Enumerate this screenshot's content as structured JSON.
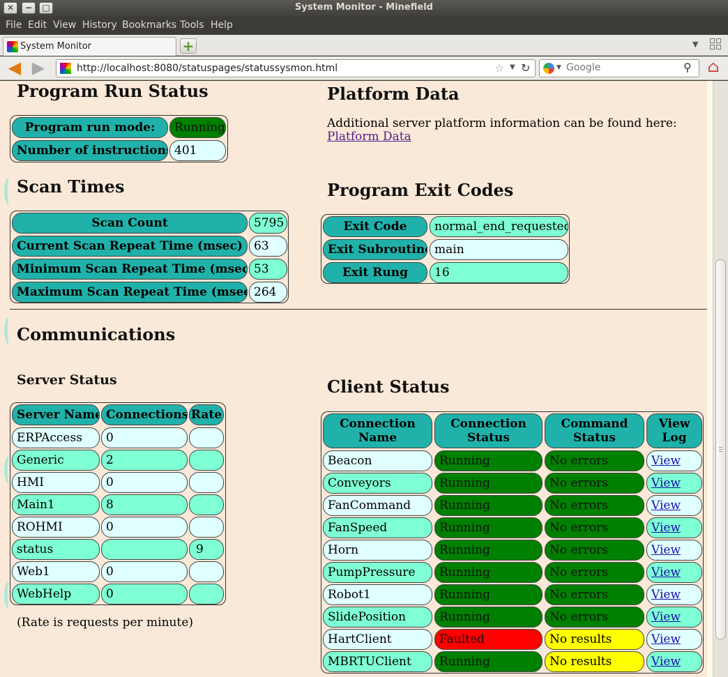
{
  "window": {
    "title": "System Monitor - Minefield"
  },
  "menu": [
    "File",
    "Edit",
    "View",
    "History",
    "Bookmarks",
    "Tools",
    "Help"
  ],
  "tab": {
    "label": "System Monitor",
    "new_tab": "+"
  },
  "nav": {
    "url": "http://localhost:8080/statuspages/statussysmon.html",
    "search_placeholder": "Google"
  },
  "program_run": {
    "title": "Program Run Status",
    "rows": [
      {
        "label": "Program run mode:",
        "value": "Running",
        "status": "green"
      },
      {
        "label": "Number of instructions",
        "value": "401",
        "status": "light"
      }
    ]
  },
  "platform": {
    "title": "Platform Data",
    "text": "Additional server platform information can be found here:",
    "link": "Platform Data"
  },
  "scan_times": {
    "title": "Scan Times",
    "rows": [
      {
        "label": "Scan Count",
        "value": "5795"
      },
      {
        "label": "Current Scan Repeat Time (msec)",
        "value": "63"
      },
      {
        "label": "Minimum Scan Repeat Time (msec)",
        "value": "53"
      },
      {
        "label": "Maximum Scan Repeat Time (msec)",
        "value": "264"
      }
    ]
  },
  "exit_codes": {
    "title": "Program Exit Codes",
    "rows": [
      {
        "label": "Exit Code",
        "value": "normal_end_requested"
      },
      {
        "label": "Exit Subroutine",
        "value": "main"
      },
      {
        "label": "Exit Rung",
        "value": "16"
      }
    ]
  },
  "communications": {
    "title": "Communications"
  },
  "server_status": {
    "title": "Server Status",
    "headers": [
      "Server Name",
      "Connections",
      "Rate"
    ],
    "rows": [
      [
        "ERPAccess",
        "0",
        ""
      ],
      [
        "Generic",
        "2",
        ""
      ],
      [
        "HMI",
        "0",
        ""
      ],
      [
        "Main1",
        "8",
        ""
      ],
      [
        "ROHMI",
        "0",
        ""
      ],
      [
        "status",
        "",
        "9"
      ],
      [
        "Web1",
        "0",
        ""
      ],
      [
        "WebHelp",
        "0",
        ""
      ]
    ],
    "note": "(Rate is requests per minute)"
  },
  "client_status": {
    "title": "Client Status",
    "headers": [
      [
        "Connection",
        "Name"
      ],
      [
        "Connection",
        "Status"
      ],
      [
        "Command",
        "Status"
      ],
      [
        "View",
        "Log"
      ]
    ],
    "rows": [
      {
        "name": "Beacon",
        "conn": "Running",
        "conn_color": "green",
        "cmd": "No errors",
        "cmd_color": "green",
        "log": "View"
      },
      {
        "name": "Conveyors",
        "conn": "Running",
        "conn_color": "green",
        "cmd": "No errors",
        "cmd_color": "green",
        "log": "View"
      },
      {
        "name": "FanCommand",
        "conn": "Running",
        "conn_color": "green",
        "cmd": "No errors",
        "cmd_color": "green",
        "log": "View"
      },
      {
        "name": "FanSpeed",
        "conn": "Running",
        "conn_color": "green",
        "cmd": "No errors",
        "cmd_color": "green",
        "log": "View"
      },
      {
        "name": "Horn",
        "conn": "Running",
        "conn_color": "green",
        "cmd": "No errors",
        "cmd_color": "green",
        "log": "View"
      },
      {
        "name": "PumpPressure",
        "conn": "Running",
        "conn_color": "green",
        "cmd": "No errors",
        "cmd_color": "green",
        "log": "View"
      },
      {
        "name": "Robot1",
        "conn": "Running",
        "conn_color": "green",
        "cmd": "No errors",
        "cmd_color": "green",
        "log": "View"
      },
      {
        "name": "SlidePosition",
        "conn": "Running",
        "conn_color": "green",
        "cmd": "No errors",
        "cmd_color": "green",
        "log": "View"
      },
      {
        "name": "HartClient",
        "conn": "Faulted",
        "conn_color": "red",
        "cmd": "No results",
        "cmd_color": "yellow",
        "log": "View"
      },
      {
        "name": "MBRTUClient",
        "conn": "Running",
        "conn_color": "green",
        "cmd": "No results",
        "cmd_color": "yellow",
        "log": "View"
      }
    ]
  },
  "colors": {
    "page_bg": "#fae9d8",
    "header_teal": "#20b2aa",
    "row_light": "#e0ffff",
    "row_aqua": "#7fffd4",
    "status_green": "#008000",
    "status_red": "#ff0000",
    "status_yellow": "#ffff00"
  }
}
